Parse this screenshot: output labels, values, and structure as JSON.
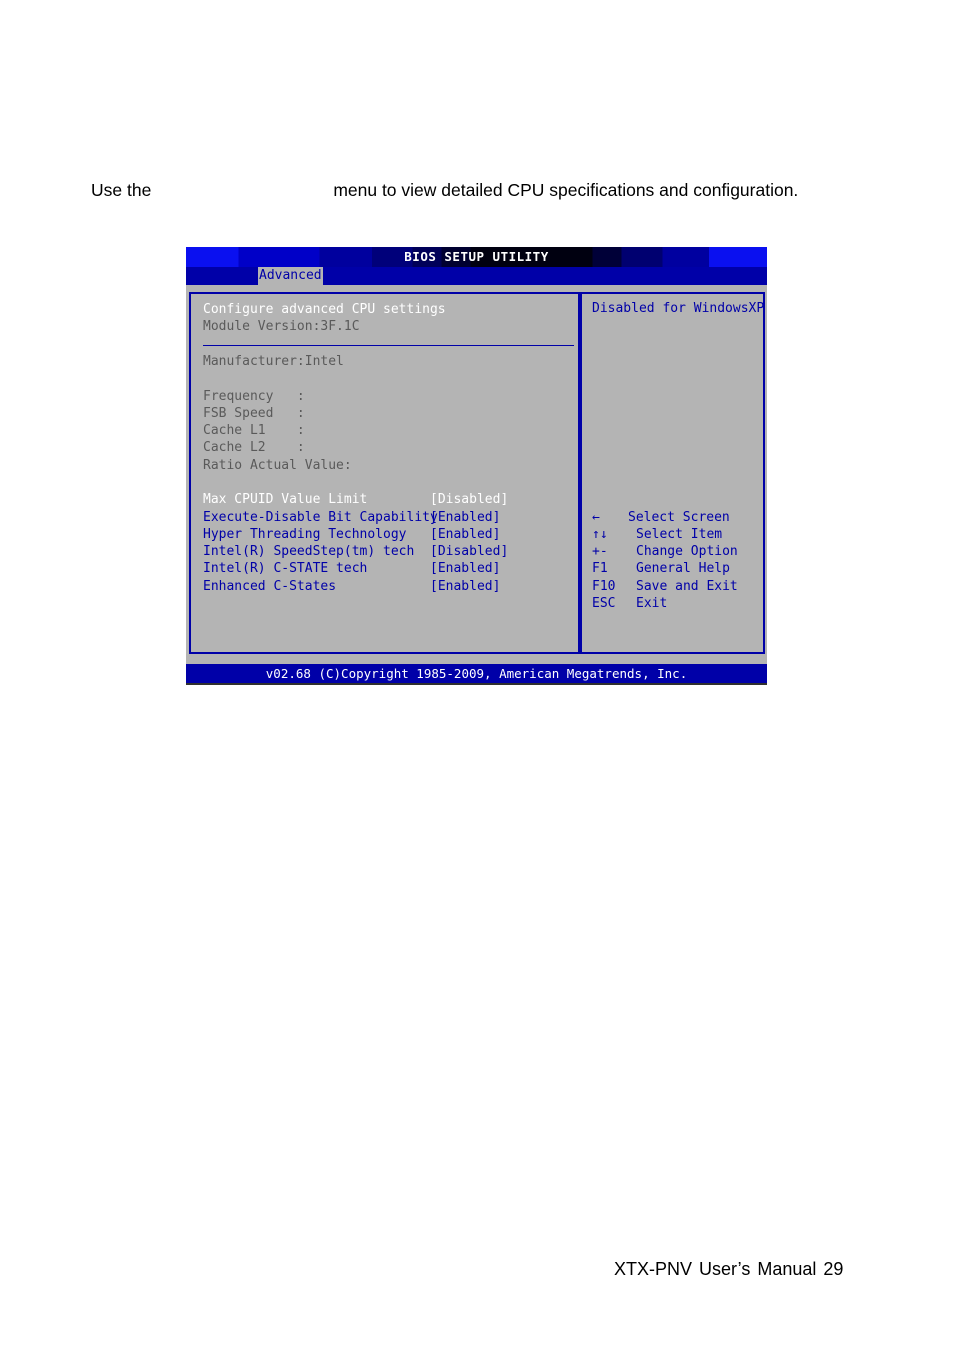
{
  "document": {
    "intro_before": "Use the",
    "intro_after": "menu to view detailed CPU specifications and configuration.",
    "footer": "XTX-PNV  User’s  Manual  29"
  },
  "bios": {
    "title": "BIOS SETUP UTILITY",
    "active_tab": "Advanced",
    "header": {
      "heading": "Configure advanced CPU settings",
      "module_version": "Module Version:3F.1C"
    },
    "info": [
      {
        "text": "Manufacturer:Intel"
      },
      {
        "text": "Frequency   :"
      },
      {
        "text": "FSB Speed   :"
      },
      {
        "text": "Cache L1    :"
      },
      {
        "text": "Cache L2    :"
      },
      {
        "text": "Ratio Actual Value:"
      }
    ],
    "options": [
      {
        "label": "Max CPUID Value Limit",
        "value": "[Disabled]",
        "selected": true
      },
      {
        "label": "Execute-Disable Bit Capability",
        "value": "[Enabled]",
        "selected": false
      },
      {
        "label": "Hyper Threading Technology",
        "value": "[Enabled]",
        "selected": false
      },
      {
        "label": "Intel(R) SpeedStep(tm) tech",
        "value": "[Disabled]",
        "selected": false
      },
      {
        "label": "Intel(R) C-STATE tech",
        "value": "[Enabled]",
        "selected": false
      },
      {
        "label": "Enhanced C-States",
        "value": "[Enabled]",
        "selected": false
      }
    ],
    "help_text": "Disabled for WindowsXP",
    "keys": [
      {
        "key": "←",
        "desc": "Select Screen"
      },
      {
        "key": "↑↓",
        "desc": "Select Item"
      },
      {
        "key": "+-",
        "desc": "Change Option"
      },
      {
        "key": "F1",
        "desc": "General Help"
      },
      {
        "key": "F10",
        "desc": "Save and Exit"
      },
      {
        "key": "ESC",
        "desc": "Exit"
      }
    ],
    "copyright": "v02.68 (C)Copyright 1985-2009, American Megatrends, Inc.",
    "colors": {
      "bios_blue": "#0000a8",
      "panel_gray": "#b4b4b4",
      "highlight_white": "#ffffff",
      "info_gray": "#5a5a5a"
    }
  }
}
